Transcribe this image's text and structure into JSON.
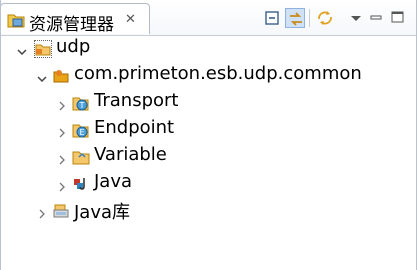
{
  "tab": {
    "title": "资源管理器"
  },
  "toolbar": {
    "collapse_all": "collapse-all",
    "link_editor": "link-with-editor",
    "sync": "sync",
    "view_menu": "view-menu",
    "minimize": "minimize",
    "maximize": "maximize"
  },
  "tree": {
    "root": {
      "label": "udp"
    },
    "package": {
      "label": "com.primeton.esb.udp.common"
    },
    "transport": {
      "label": "Transport"
    },
    "endpoint": {
      "label": "Endpoint"
    },
    "variable": {
      "label": "Variable"
    },
    "java": {
      "label": "Java"
    },
    "javalib": {
      "label": "Java库"
    }
  }
}
